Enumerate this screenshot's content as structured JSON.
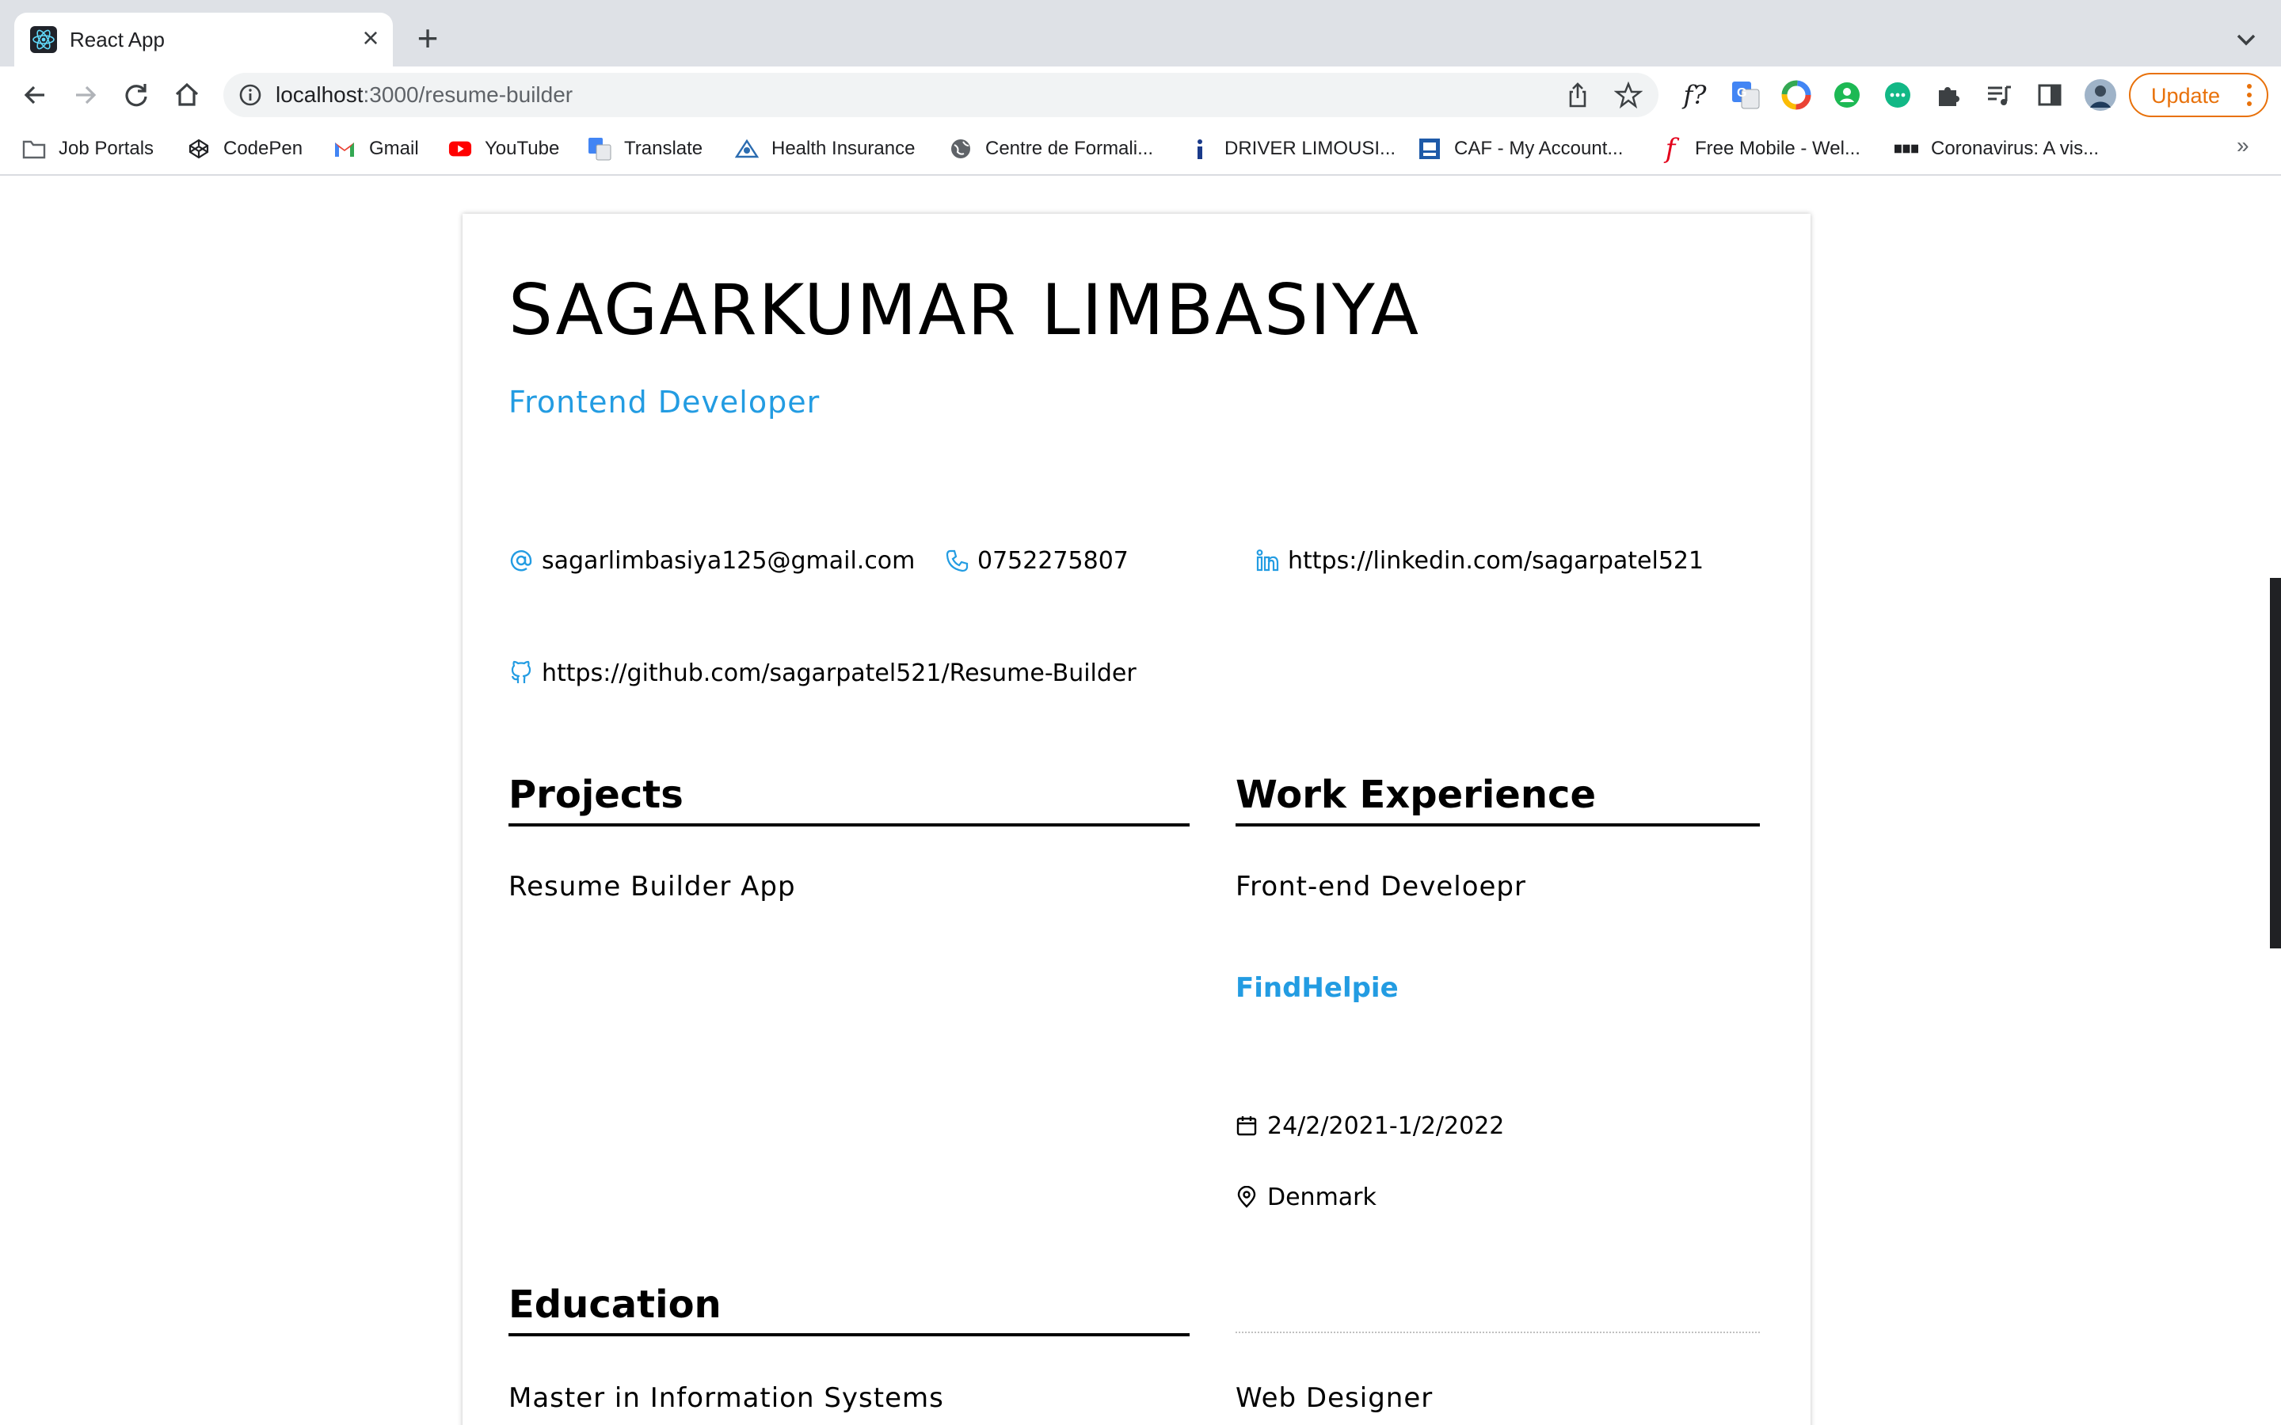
{
  "browser": {
    "tab_title": "React App",
    "url_host": "localhost",
    "url_path": ":3000/resume-builder",
    "update_label": "Update",
    "accent_color": "#e8710a"
  },
  "bookmarks": [
    {
      "label": "Job Portals",
      "icon": "folder-icon"
    },
    {
      "label": "CodePen",
      "icon": "codepen-icon"
    },
    {
      "label": "Gmail",
      "icon": "gmail-icon"
    },
    {
      "label": "YouTube",
      "icon": "youtube-icon"
    },
    {
      "label": "Translate",
      "icon": "translate-icon"
    },
    {
      "label": "Health Insurance",
      "icon": "health-insurance-icon"
    },
    {
      "label": "Centre de Formali...",
      "icon": "globe-icon"
    },
    {
      "label": "DRIVER LIMOUSI...",
      "icon": "info-icon"
    },
    {
      "label": "CAF - My Account...",
      "icon": "caf-icon"
    },
    {
      "label": "Free Mobile - Wel...",
      "icon": "free-mobile-icon"
    },
    {
      "label": "Coronavirus: A vis...",
      "icon": "bbc-icon"
    }
  ],
  "resume": {
    "name": "SAGARKUMAR LIMBASIYA",
    "role": "Frontend Developer",
    "accent_color": "#239ce2",
    "contacts": {
      "email": "sagarlimbasiya125@gmail.com",
      "phone": "0752275807",
      "linkedin": "https://linkedin.com/sagarpatel521",
      "github": "https://github.com/sagarpatel521/Resume-Builder"
    },
    "projects": {
      "heading": "Projects",
      "items": [
        "Resume Builder App"
      ]
    },
    "work": {
      "heading": "Work Experience",
      "items": [
        {
          "title": "Front-end Develoepr",
          "company": "FindHelpie",
          "dates": "24/2/2021-1/2/2022",
          "location": "Denmark"
        },
        {
          "title": "Web Designer"
        }
      ]
    },
    "education": {
      "heading": "Education",
      "items": [
        "Master in Information Systems"
      ]
    }
  }
}
